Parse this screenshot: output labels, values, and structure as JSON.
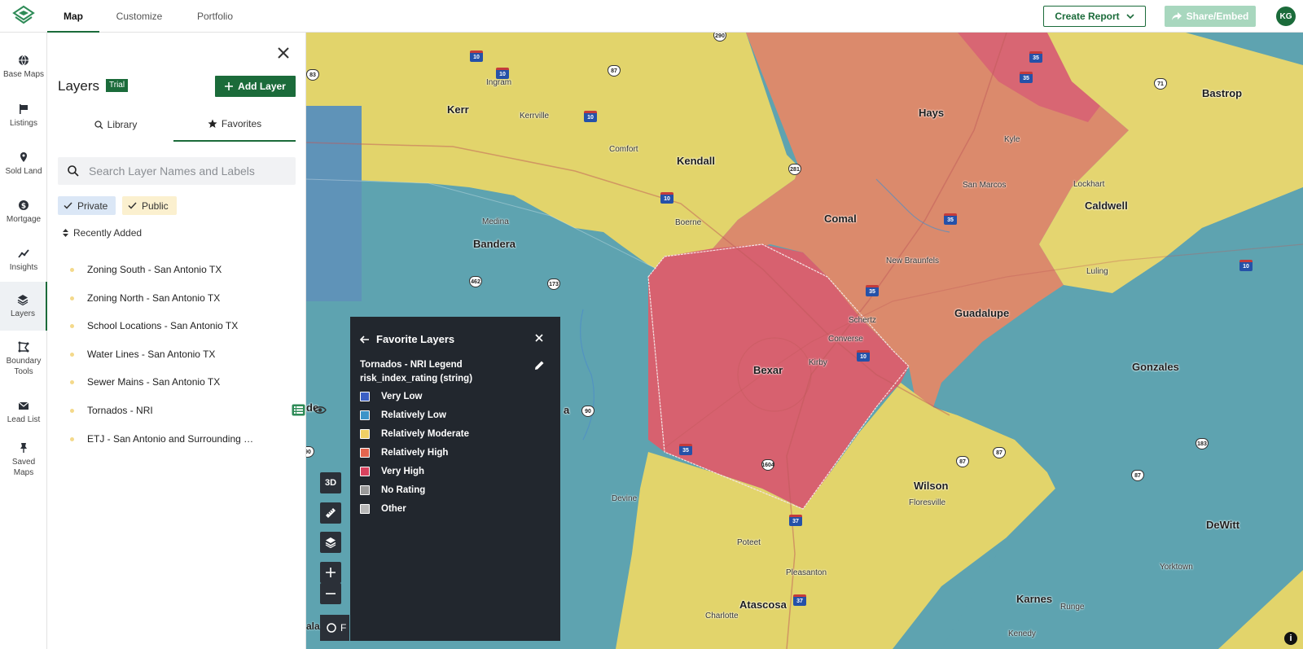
{
  "topbar": {
    "tabs": [
      {
        "label": "Map",
        "active": true
      },
      {
        "label": "Customize",
        "active": false
      },
      {
        "label": "Portfolio",
        "active": false
      }
    ],
    "create_report": "Create Report",
    "share_embed": "Share/Embed",
    "avatar_initials": "KG"
  },
  "rail": {
    "items": [
      {
        "label": "Base Maps",
        "icon": "globe-icon"
      },
      {
        "label": "Listings",
        "icon": "flag-icon"
      },
      {
        "label": "Sold Land",
        "icon": "pin-icon"
      },
      {
        "label": "Mortgage",
        "icon": "dollar-icon"
      },
      {
        "label": "Insights",
        "icon": "trend-icon"
      },
      {
        "label": "Layers",
        "icon": "layers-icon",
        "active": true
      },
      {
        "label": "Boundary Tools",
        "icon": "boundary-icon"
      },
      {
        "label": "Lead List",
        "icon": "mail-icon"
      },
      {
        "label": "Saved Maps",
        "icon": "thumbtack-icon"
      }
    ]
  },
  "panel": {
    "title": "Layers",
    "badge": "Trial",
    "add_layer": "Add Layer",
    "tabs": [
      {
        "label": "Library",
        "active": false
      },
      {
        "label": "Favorites",
        "active": true
      }
    ],
    "search_placeholder": "Search Layer Names and Labels",
    "chips": [
      "Private",
      "Public"
    ],
    "sort_label": "Recently Added",
    "layers": [
      "Zoning South - San Antonio TX",
      "Zoning North - San Antonio TX",
      "School Locations - San Antonio TX",
      "Water Lines - San Antonio TX",
      "Sewer Mains - San Antonio TX",
      "Tornados - NRI",
      "ETJ - San Antonio and Surrounding C..."
    ]
  },
  "legend": {
    "back_label": "Favorite Layers",
    "title": "Tornados - NRI Legend",
    "field": "risk_index_rating (string)",
    "items": [
      {
        "label": "Very Low",
        "color": "#3b5fc4"
      },
      {
        "label": "Relatively Low",
        "color": "#3c93c8"
      },
      {
        "label": "Relatively Moderate",
        "color": "#f0d065"
      },
      {
        "label": "Relatively High",
        "color": "#e3654f"
      },
      {
        "label": "Very High",
        "color": "#d8425e"
      },
      {
        "label": "No Rating",
        "color": "#9a9a9a"
      },
      {
        "label": "Other",
        "color": "#b8b8b8"
      }
    ]
  },
  "map": {
    "counties": [
      "Kerr",
      "Kendall",
      "Hays",
      "Bastrop",
      "Bandera",
      "Comal",
      "Caldwell",
      "Guadalupe",
      "Bexar",
      "Gonzales",
      "Wilson",
      "DeWitt",
      "Atascosa",
      "Karnes"
    ],
    "towns": [
      "Ingram",
      "Kerrville",
      "Comfort",
      "Kyle",
      "Lockhart",
      "San Marcos",
      "Medina",
      "Boerne",
      "New Braunfels",
      "Luling",
      "Schertz",
      "Converse",
      "Kirby",
      "Floresville",
      "Devine",
      "Poteet",
      "Pleasanton",
      "Charlotte",
      "Yorktown",
      "Runge",
      "Kenedy"
    ],
    "partial_labels": [
      "de",
      "a",
      "ala",
      "F"
    ],
    "controls": {
      "three_d": "3D"
    }
  }
}
